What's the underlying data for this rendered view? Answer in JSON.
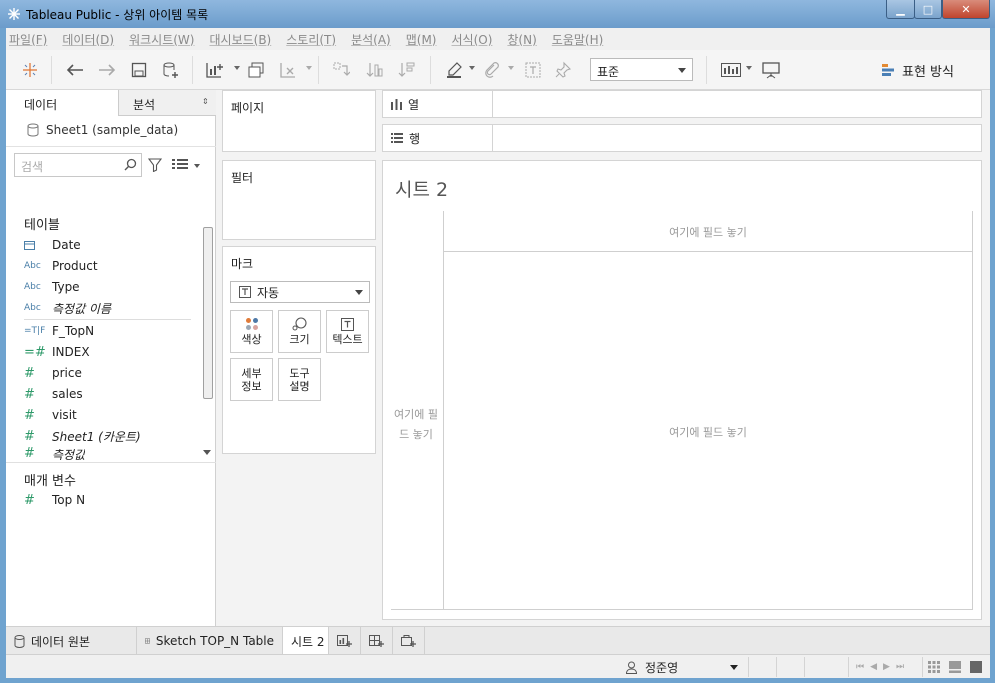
{
  "window": {
    "title": "Tableau Public - 상위 아이템 목록",
    "minimize": "▁",
    "maximize": "□",
    "close": "✕"
  },
  "menu": [
    "파일(F)",
    "데이터(D)",
    "워크시트(W)",
    "대시보드(B)",
    "스토리(T)",
    "분석(A)",
    "맵(M)",
    "서식(O)",
    "창(N)",
    "도움말(H)"
  ],
  "toolbar": {
    "fit_select": "표준",
    "show_me": "표현 방식"
  },
  "data_pane": {
    "tab_data": "데이터",
    "tab_analysis": "분석",
    "datasource": "Sheet1 (sample_data)",
    "search_placeholder": "검색",
    "tables_title": "테이블",
    "dimensions": [
      {
        "icon": "calendar",
        "name": "Date"
      },
      {
        "icon": "Abc",
        "name": "Product"
      },
      {
        "icon": "Abc",
        "name": "Type"
      },
      {
        "icon": "Abc",
        "name": "측정값 이름"
      }
    ],
    "measures": [
      {
        "icon": "=T|F",
        "name": "F_TopN"
      },
      {
        "icon": "=#",
        "name": "INDEX"
      },
      {
        "icon": "#",
        "name": "price"
      },
      {
        "icon": "#",
        "name": "sales"
      },
      {
        "icon": "#",
        "name": "visit"
      },
      {
        "icon": "#",
        "name": "Sheet1 (카운트)"
      },
      {
        "icon": "#",
        "name": "측정값"
      }
    ],
    "parameters_title": "매개 변수",
    "parameters": [
      {
        "icon": "#",
        "name": "Top N"
      }
    ]
  },
  "cards": {
    "pages": "페이지",
    "filters": "필터",
    "marks": "마크",
    "mark_type": "자동",
    "mark_buttons": {
      "color": "색상",
      "size": "크기",
      "text": "텍스트",
      "detail": "세부\n정보",
      "tooltip": "도구\n설명"
    }
  },
  "shelves": {
    "columns": "열",
    "rows": "행"
  },
  "viz": {
    "sheet_title": "시트 2",
    "drop_columns": "여기에 필드 놓기",
    "drop_rows": "여기에 필드 놓기",
    "drop_main": "여기에 필드 놓기"
  },
  "tabs": {
    "datasource": "데이터 원본",
    "sheet1": "Sketch TOP_N Table",
    "sheet2": "시트 2"
  },
  "status": {
    "user": "정준영"
  },
  "colors": {
    "titlebar": "#6b9ccb",
    "dimension_icon": "#4a7fa8",
    "measure_icon": "#2f9a6a"
  }
}
